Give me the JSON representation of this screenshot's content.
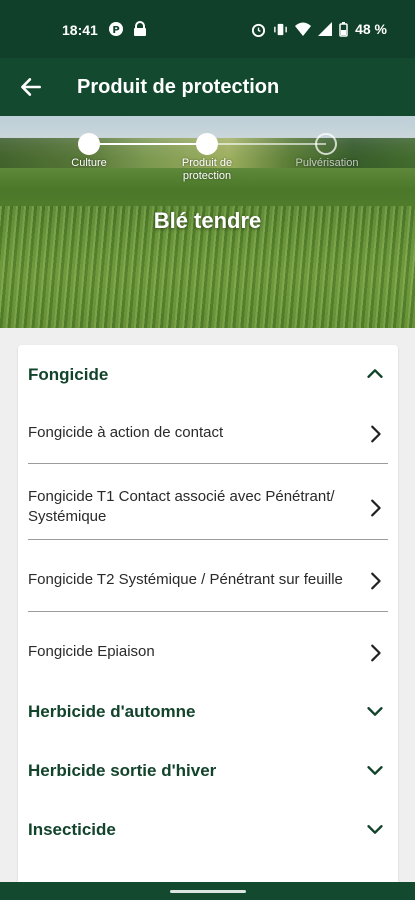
{
  "status_bar": {
    "time": "18:41",
    "battery": "48 %",
    "left_icons": [
      "app-notification-icon",
      "lock-icon"
    ],
    "right_icons": [
      "alarm-icon",
      "vibrate-icon",
      "wifi-icon",
      "signal-icon",
      "battery-icon"
    ]
  },
  "app_bar": {
    "title": "Produit de protection",
    "background_color": "#12492f"
  },
  "stepper": {
    "steps": [
      {
        "label": "Culture",
        "state": "completed"
      },
      {
        "label": "Produit de protection",
        "state": "active"
      },
      {
        "label": "Pulvérisation",
        "state": "inactive"
      }
    ]
  },
  "hero": {
    "crop_title": "Blé tendre"
  },
  "categories": [
    {
      "label": "Fongicide",
      "expanded": true,
      "items": [
        {
          "label": "Fongicide à action de contact"
        },
        {
          "label": "Fongicide T1 Contact associé avec Pénétrant/ Systémique"
        },
        {
          "label": "Fongicide T2 Systémique / Pénétrant sur feuille"
        },
        {
          "label": "Fongicide Epiaison"
        }
      ]
    },
    {
      "label": "Herbicide d'automne",
      "expanded": false
    },
    {
      "label": "Herbicide sortie d'hiver",
      "expanded": false
    },
    {
      "label": "Insecticide",
      "expanded": false
    }
  ],
  "colors": {
    "primary_dark": "#10402a",
    "primary": "#12492f",
    "section_text": "#12432b",
    "background": "#efefef"
  }
}
